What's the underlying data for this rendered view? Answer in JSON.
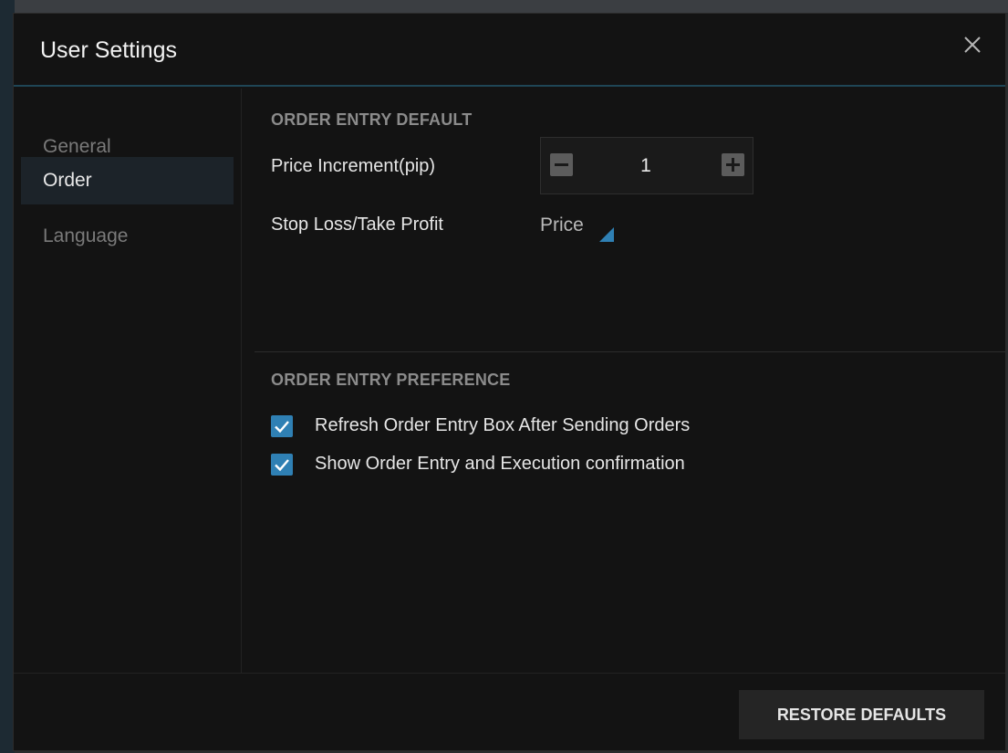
{
  "dialog": {
    "title": "User Settings",
    "close_icon": "close-icon"
  },
  "sidebar": {
    "items": [
      {
        "label": "General",
        "active": false
      },
      {
        "label": "Order",
        "active": true
      },
      {
        "label": "Language",
        "active": false
      }
    ]
  },
  "order_entry_default": {
    "section_title": "ORDER ENTRY DEFAULT",
    "price_increment": {
      "label": "Price Increment(pip)",
      "value": "1",
      "decrement_icon": "minus-icon",
      "increment_icon": "plus-icon"
    },
    "stop_loss": {
      "label": "Stop Loss/Take Profit",
      "selected": "Price",
      "caret_icon": "dropdown-caret-icon"
    }
  },
  "order_entry_preference": {
    "section_title": "ORDER ENTRY PREFERENCE",
    "options": [
      {
        "label": "Refresh Order Entry Box After Sending Orders",
        "checked": true
      },
      {
        "label": "Show Order Entry and Execution confirmation",
        "checked": true
      }
    ]
  },
  "footer": {
    "restore_label": "RESTORE DEFAULTS"
  },
  "colors": {
    "accent": "#2f80b4",
    "background": "#131313",
    "active_nav": "#1c2329",
    "title_border": "#1f4656"
  }
}
